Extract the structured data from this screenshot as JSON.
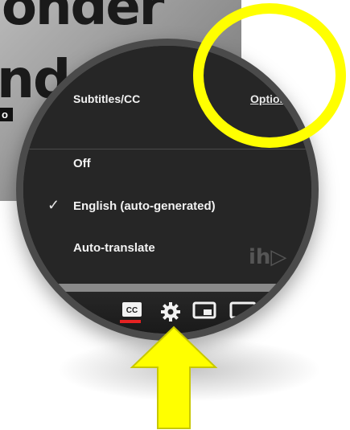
{
  "background": {
    "headline_top": "onder",
    "headline_bottom": "nds",
    "tag": "o"
  },
  "subtitles_menu": {
    "back_icon": "chevron-left-icon",
    "title": "Subtitles/CC",
    "options_label": "Options",
    "items": [
      {
        "label": "Off",
        "selected": false
      },
      {
        "label": "English (auto-generated)",
        "selected": true,
        "check_glyph": "✓"
      },
      {
        "label": "Auto-translate",
        "selected": false
      }
    ]
  },
  "player_controls": {
    "cc_label": "CC",
    "cc_active_color": "#e52222",
    "icons": [
      "cc-icon",
      "gear-icon",
      "miniplayer-icon",
      "theater-icon"
    ]
  },
  "annotation": {
    "highlight_color": "#ffff00",
    "marks": [
      "highlight-circle",
      "pointer-arrow"
    ]
  }
}
